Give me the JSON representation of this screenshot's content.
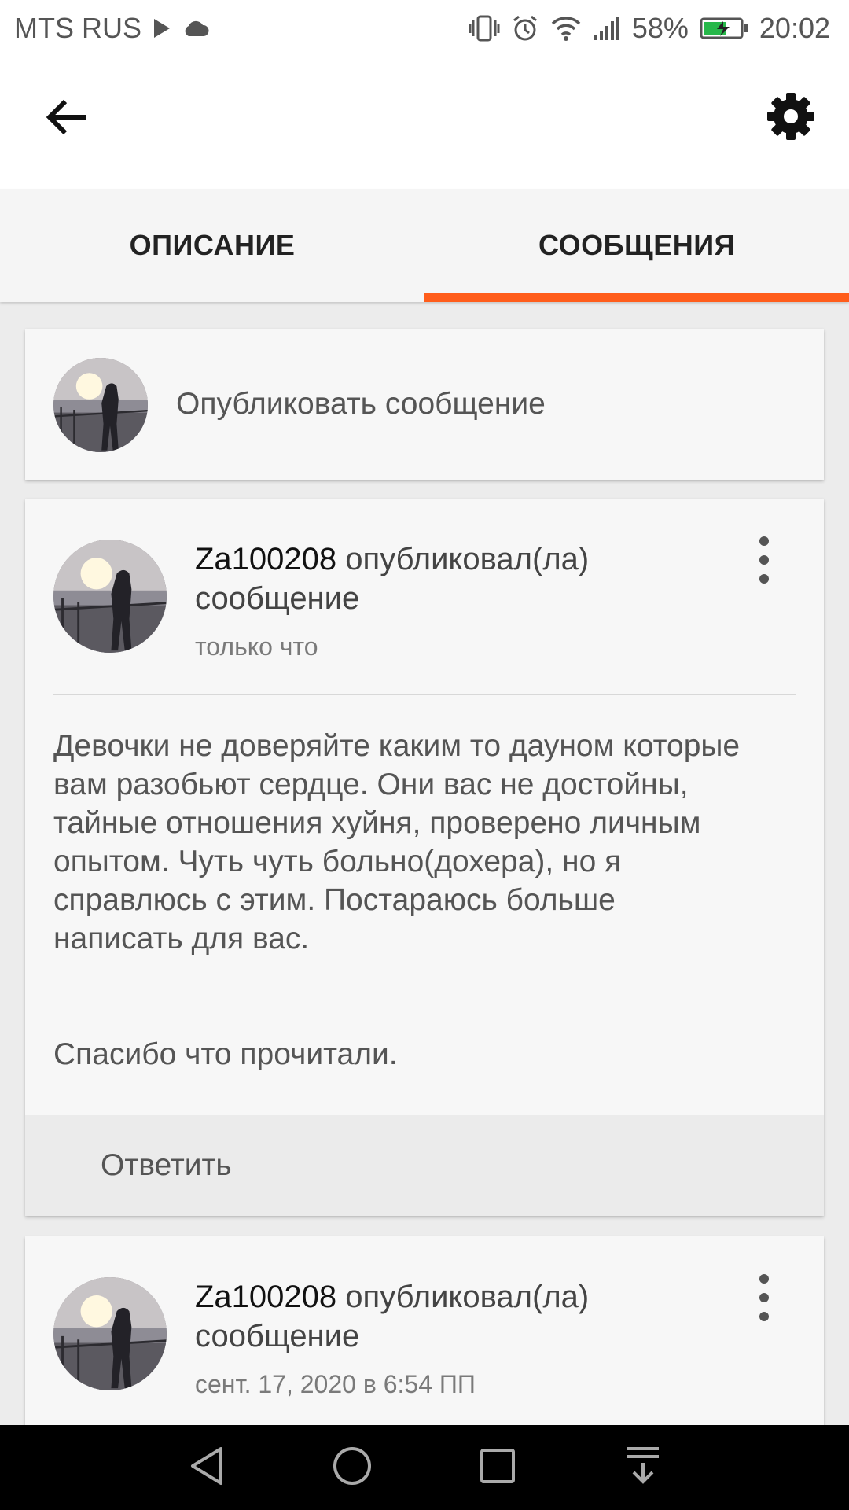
{
  "status_bar": {
    "carrier": "MTS RUS",
    "battery_percent": "58%",
    "time": "20:02",
    "icons": [
      "play-icon",
      "cloud-icon",
      "vibrate-icon",
      "alarm-icon",
      "wifi-icon",
      "signal-icon",
      "battery-icon"
    ]
  },
  "app_bar": {
    "back_icon": "arrow-left-icon",
    "settings_icon": "gear-icon"
  },
  "tabs": [
    {
      "label": "ОПИСАНИЕ",
      "active": false
    },
    {
      "label": "СООБЩЕНИЯ",
      "active": true
    }
  ],
  "accent_color": "#ff5d1b",
  "compose": {
    "placeholder": "Опубликовать сообщение"
  },
  "posts": [
    {
      "username": "Za100208",
      "action": "опубликовал(ла) сообщение",
      "time": "только что",
      "body": "Девочки не доверяйте каким то дауном которые вам разобьют сердце. Они вас не достойны, тайные отношения хуйня, проверено личным опытом. Чуть чуть больно(дохера), но я справлюсь с этим. Постараюсь больше написать для вас.\n\n\nСпасибо что прочитали.",
      "reply_label": "Ответить"
    },
    {
      "username": "Za100208",
      "action": "опубликовал(ла) сообщение",
      "time": "сент. 17, 2020 в 6:54 ПП"
    }
  ],
  "nav_bar": {
    "buttons": [
      "back-triangle-icon",
      "home-circle-icon",
      "recents-square-icon",
      "notifications-pull-icon"
    ]
  }
}
